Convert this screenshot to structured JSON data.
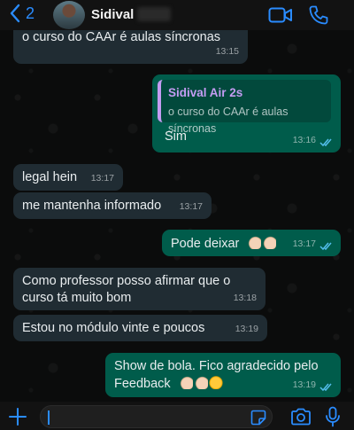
{
  "header": {
    "back_count": "2",
    "contact_name": "Sidival"
  },
  "messages": [
    {
      "text": "o curso do CAAr é aulas síncronas",
      "time": "13:15"
    },
    {
      "reply_name": "Sidival Air 2s",
      "reply_text": "o curso do CAAr é aulas síncronas",
      "text": "Sim",
      "time": "13:16"
    },
    {
      "text": "legal hein",
      "time": "13:17"
    },
    {
      "text": "me mantenha informado",
      "time": "13:17"
    },
    {
      "text": "Pode deixar",
      "time": "13:17"
    },
    {
      "line1": "Como professor posso afirmar que o",
      "line2": "curso tá muito bom",
      "time": "13:18"
    },
    {
      "text": "Estou no módulo vinte e poucos",
      "time": "13:19"
    },
    {
      "line1": "Show de bola. Fico agradecido pelo",
      "line2": "Feedback",
      "time": "13:19"
    }
  ],
  "composer": {
    "value": ""
  },
  "colors": {
    "accent": "#2a8cff",
    "outgoing": "#005c4b",
    "incoming": "#202c33",
    "read_ticks": "#53bdeb",
    "reply_name": "#c49cf2"
  },
  "icons": [
    "chevron-left-icon",
    "video-call-icon",
    "phone-icon",
    "plus-icon",
    "sticker-icon",
    "camera-icon",
    "microphone-icon",
    "thumbs-up-emoji",
    "handshake-emoji",
    "double-check-icon"
  ]
}
